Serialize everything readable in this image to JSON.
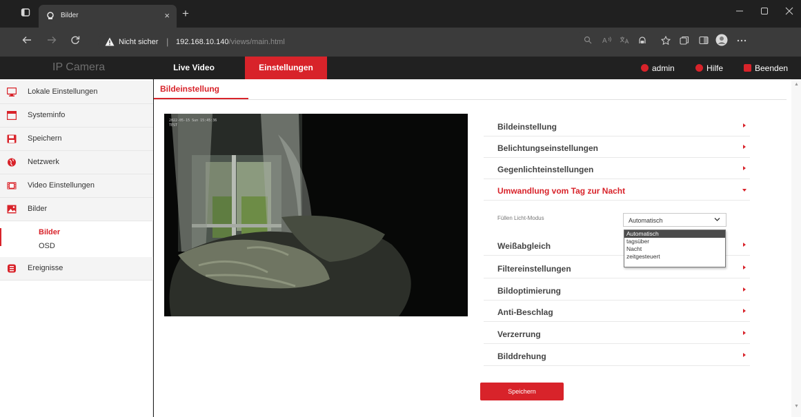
{
  "browser": {
    "tab_title": "Bilder",
    "new_tab_glyph": "+",
    "tab_close_glyph": "×",
    "security_label": "Nicht sicher",
    "url_host": "192.168.10.140",
    "url_path": "/views/main.html",
    "icons": [
      "tab-actions-icon",
      "favicon",
      "back-icon",
      "forward-icon",
      "reload-icon",
      "warning-icon",
      "search-icon",
      "read-aloud-icon",
      "translate-icon",
      "tracking-icon",
      "favorites-icon",
      "collections-icon",
      "split-icon",
      "profile-icon",
      "more-icon",
      "minimize-icon",
      "maximize-icon",
      "close-icon"
    ]
  },
  "header": {
    "brand": "IP Camera",
    "tabs": [
      {
        "label": "Live Video",
        "active": false
      },
      {
        "label": "Einstellungen",
        "active": true
      }
    ],
    "user": "admin",
    "help": "Hilfe",
    "logout": "Beenden",
    "accent_color": "#d8232a"
  },
  "sidebar": {
    "items": [
      {
        "label": "Lokale Einstellungen",
        "icon": "monitor-icon"
      },
      {
        "label": "Systeminfo",
        "icon": "info-window-icon"
      },
      {
        "label": "Speichern",
        "icon": "save-icon"
      },
      {
        "label": "Netzwerk",
        "icon": "globe-icon"
      },
      {
        "label": "Video Einstellungen",
        "icon": "film-icon"
      },
      {
        "label": "Bilder",
        "icon": "image-icon"
      },
      {
        "label": "Ereignisse",
        "icon": "events-icon"
      }
    ],
    "subitems": [
      {
        "label": "Bilder",
        "active": true
      },
      {
        "label": "OSD",
        "active": false
      }
    ]
  },
  "main": {
    "subtab": "Bildeinstellung",
    "video_timestamp": "2022-05-15 Sun 15:45:36",
    "video_label": "TEST",
    "menu": [
      {
        "label": "Bildeinstellung",
        "open": false
      },
      {
        "label": "Belichtungseinstellungen",
        "open": false
      },
      {
        "label": "Gegenlichteinstellungen",
        "open": false
      },
      {
        "label": "Umwandlung vom Tag zur Nacht",
        "open": true
      },
      {
        "label": "Weißabgleich",
        "open": false
      },
      {
        "label": "Filtereinstellungen",
        "open": false
      },
      {
        "label": "Bildoptimierung",
        "open": false
      },
      {
        "label": "Anti-Beschlag",
        "open": false
      },
      {
        "label": "Verzerrung",
        "open": false
      },
      {
        "label": "Bilddrehung",
        "open": false
      }
    ],
    "fill_light": {
      "label": "Füllen Licht-Modus",
      "value": "Automatisch",
      "options": [
        "Automatisch",
        "tagsüber",
        "Nacht",
        "zeitgesteuert"
      ]
    },
    "save_label": "Speichern"
  }
}
